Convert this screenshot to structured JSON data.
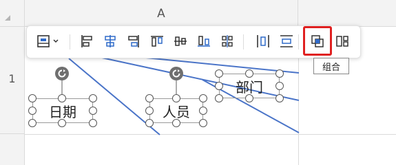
{
  "sheet": {
    "column_a": "A",
    "row_1": "1"
  },
  "shapes": {
    "date_label": "日期",
    "person_label": "人员",
    "dept_label": "部门"
  },
  "toolbar": {
    "items": [
      {
        "name": "align-dropdown",
        "icon": "align-dropdown-icon"
      },
      {
        "name": "align-left",
        "icon": "align-left-icon"
      },
      {
        "name": "align-center",
        "icon": "align-center-icon"
      },
      {
        "name": "align-right",
        "icon": "align-right-icon"
      },
      {
        "name": "align-top",
        "icon": "align-top-icon"
      },
      {
        "name": "align-middle",
        "icon": "align-middle-icon"
      },
      {
        "name": "align-bottom",
        "icon": "align-bottom-icon"
      },
      {
        "name": "align-more",
        "icon": "align-grid-icon"
      },
      {
        "name": "distribute-horizontal",
        "icon": "distribute-horizontal-icon"
      },
      {
        "name": "distribute-vertical",
        "icon": "distribute-vertical-icon"
      },
      {
        "name": "group",
        "icon": "group-icon"
      },
      {
        "name": "ungroup",
        "icon": "ungroup-icon"
      }
    ],
    "group_tooltip": "组合"
  },
  "colors": {
    "accent": "#2f6ac9",
    "highlight": "#e02020",
    "connector": "#4a74c8"
  }
}
